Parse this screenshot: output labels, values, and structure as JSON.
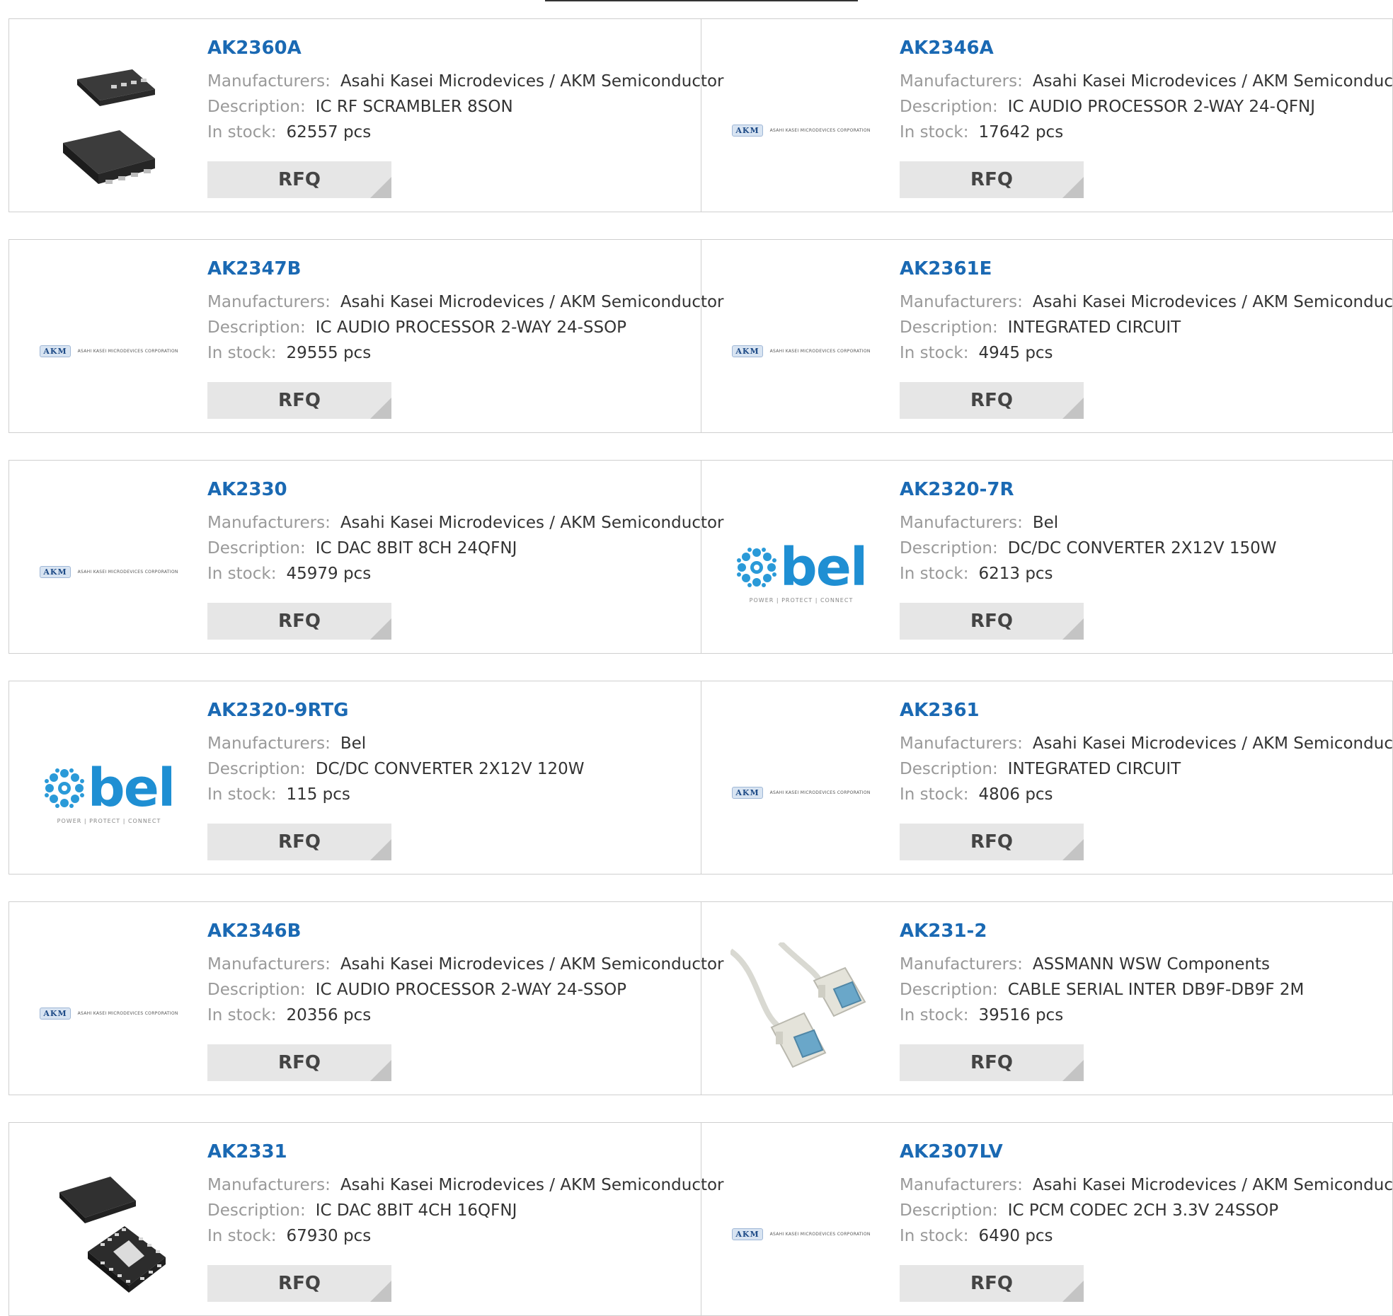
{
  "labels": {
    "manufacturers": "Manufacturers:",
    "description": "Description:",
    "stock": "In stock:",
    "rfq": "RFQ"
  },
  "logos": {
    "akm_mark": "AKM",
    "akm_text": "ASAHI KASEI MICRODEVICES CORPORATION",
    "bel_word": "bel",
    "bel_tagline": "POWER | PROTECT | CONNECT"
  },
  "products": [
    {
      "name": "AK2360A",
      "manufacturer": "Asahi Kasei Microdevices / AKM Semiconductor",
      "description": "IC RF SCRAMBLER 8SON",
      "stock": "62557 pcs",
      "image": "chip-8son-image"
    },
    {
      "name": "AK2346A",
      "manufacturer": "Asahi Kasei Microdevices / AKM Semiconductor",
      "description": "IC AUDIO PROCESSOR 2-WAY 24-QFNJ",
      "stock": "17642 pcs",
      "image": "akm-logo"
    },
    {
      "name": "AK2347B",
      "manufacturer": "Asahi Kasei Microdevices / AKM Semiconductor",
      "description": "IC AUDIO PROCESSOR 2-WAY 24-SSOP",
      "stock": "29555 pcs",
      "image": "akm-logo"
    },
    {
      "name": "AK2361E",
      "manufacturer": "Asahi Kasei Microdevices / AKM Semiconductor",
      "description": "INTEGRATED CIRCUIT",
      "stock": "4945 pcs",
      "image": "akm-logo"
    },
    {
      "name": "AK2330",
      "manufacturer": "Asahi Kasei Microdevices / AKM Semiconductor",
      "description": "IC DAC 8BIT 8CH 24QFNJ",
      "stock": "45979 pcs",
      "image": "akm-logo"
    },
    {
      "name": "AK2320-7R",
      "manufacturer": "Bel",
      "description": "DC/DC CONVERTER 2X12V 150W",
      "stock": "6213 pcs",
      "image": "bel-logo"
    },
    {
      "name": "AK2320-9RTG",
      "manufacturer": "Bel",
      "description": "DC/DC CONVERTER 2X12V 120W",
      "stock": "115 pcs",
      "image": "bel-logo"
    },
    {
      "name": "AK2361",
      "manufacturer": "Asahi Kasei Microdevices / AKM Semiconductor",
      "description": "INTEGRATED CIRCUIT",
      "stock": "4806 pcs",
      "image": "akm-logo"
    },
    {
      "name": "AK2346B",
      "manufacturer": "Asahi Kasei Microdevices / AKM Semiconductor",
      "description": "IC AUDIO PROCESSOR 2-WAY 24-SSOP",
      "stock": "20356 pcs",
      "image": "akm-logo"
    },
    {
      "name": "AK231-2",
      "manufacturer": "ASSMANN WSW Components",
      "description": "CABLE SERIAL INTER DB9F-DB9F 2M",
      "stock": "39516 pcs",
      "image": "serial-cable-image"
    },
    {
      "name": "AK2331",
      "manufacturer": "Asahi Kasei Microdevices / AKM Semiconductor",
      "description": "IC DAC 8BIT 4CH 16QFNJ",
      "stock": "67930 pcs",
      "image": "chip-qfn16-image"
    },
    {
      "name": "AK2307LV",
      "manufacturer": "Asahi Kasei Microdevices / AKM Semiconductor",
      "description": "IC PCM CODEC 2CH 3.3V 24SSOP",
      "stock": "6490 pcs",
      "image": "akm-logo"
    }
  ]
}
